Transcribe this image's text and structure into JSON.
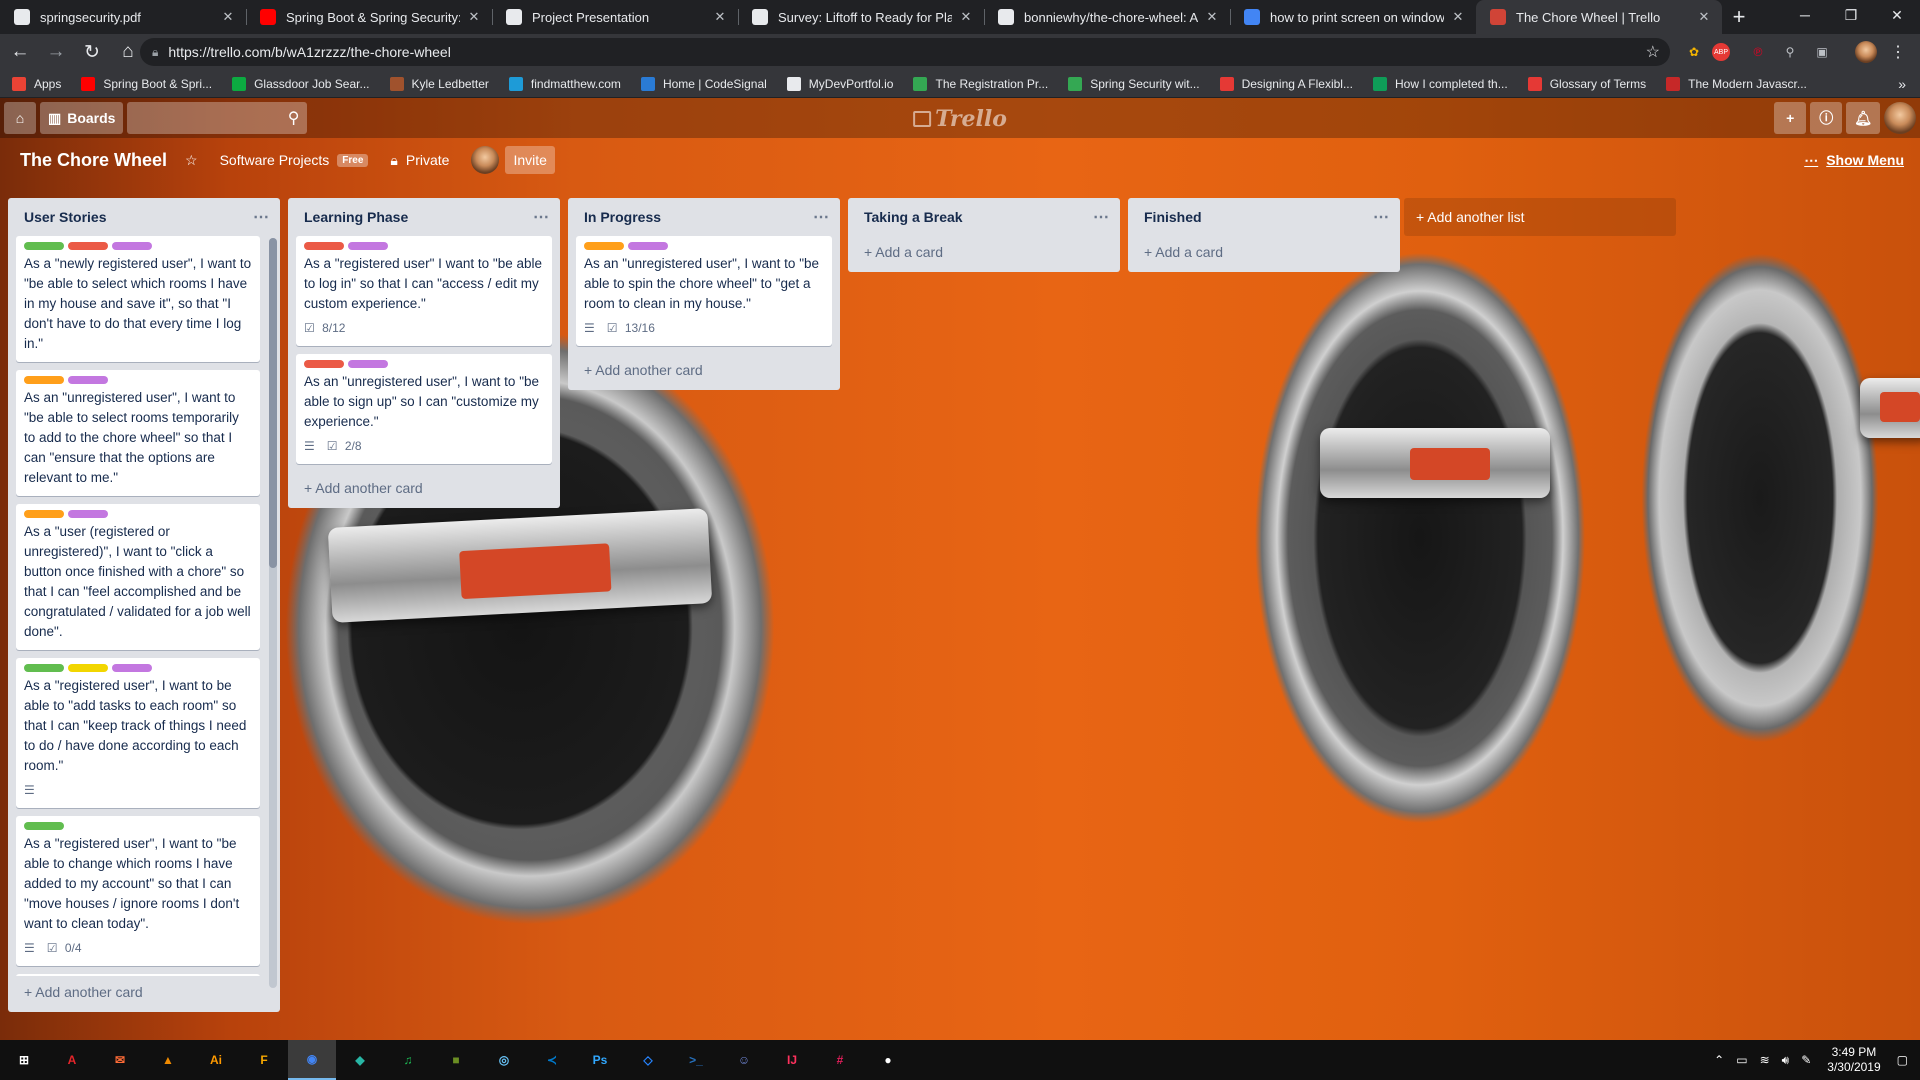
{
  "browser": {
    "tabs": [
      {
        "title": "springsecurity.pdf",
        "icon": "document-icon",
        "color": "#e8eaed"
      },
      {
        "title": "Spring Boot & Spring Security: D",
        "icon": "youtube-icon",
        "color": "#ff0000"
      },
      {
        "title": "Project Presentation",
        "icon": "presentation-icon",
        "color": "#e8eaed"
      },
      {
        "title": "Survey: Liftoff to Ready for Placem",
        "icon": "survey-icon",
        "color": "#e8eaed"
      },
      {
        "title": "bonniewhy/the-chore-wheel: A h",
        "icon": "github-icon",
        "color": "#e8eaed"
      },
      {
        "title": "how to print screen on windows",
        "icon": "google-icon",
        "color": "#4285f4"
      },
      {
        "title": "The Chore Wheel | Trello",
        "icon": "trello-icon",
        "color": "#d04437",
        "active": true
      }
    ],
    "url": "https://trello.com/b/wA1zrzzz/the-chore-wheel",
    "bookmarks": [
      {
        "label": "Apps",
        "color": "#ea4335"
      },
      {
        "label": "Spring Boot & Spri...",
        "color": "#ff0000"
      },
      {
        "label": "Glassdoor Job Sear...",
        "color": "#0caa41"
      },
      {
        "label": "Kyle Ledbetter",
        "color": "#a0522d"
      },
      {
        "label": "findmatthew.com",
        "color": "#1e9bd7"
      },
      {
        "label": "Home | CodeSignal",
        "color": "#2a7bd5"
      },
      {
        "label": "MyDevPortfol.io",
        "color": "#e8eaed"
      },
      {
        "label": "The Registration Pr...",
        "color": "#34a853"
      },
      {
        "label": "Spring Security wit...",
        "color": "#34a853"
      },
      {
        "label": "Designing A Flexibl...",
        "color": "#e53935"
      },
      {
        "label": "How I completed th...",
        "color": "#0f9d58"
      },
      {
        "label": "Glossary of Terms",
        "color": "#e53935"
      },
      {
        "label": "The Modern Javascr...",
        "color": "#c62828"
      }
    ]
  },
  "trello": {
    "boards_label": "Boards",
    "logo": "Trello",
    "board_title": "The Chore Wheel",
    "team": "Software Projects",
    "team_badge": "Free",
    "visibility": "Private",
    "invite": "Invite",
    "show_menu": "Show Menu",
    "add_list": "+ Add another list",
    "lists": [
      {
        "title": "User Stories",
        "add": "+ Add another card",
        "cards": [
          {
            "labels": [
              "#61bd4f",
              "#eb5a46",
              "#c377e0"
            ],
            "text": "As a \"newly registered user\", I want to \"be able to select which rooms I have in my house and save it\", so that \"I don't have to do that every time I log in.\""
          },
          {
            "labels": [
              "#ff9f1a",
              "#c377e0"
            ],
            "text": "As an \"unregistered user\", I want to \"be able to select rooms temporarily to add to the chore wheel\" so that I can \"ensure that the options are relevant to me.\""
          },
          {
            "labels": [
              "#ff9f1a",
              "#c377e0"
            ],
            "text": "As a \"user (registered or unregistered)\", I want to \"click a button once finished with a chore\" so that I can \"feel accomplished and be congratulated / validated for a job well done\"."
          },
          {
            "labels": [
              "#61bd4f",
              "#f2d600",
              "#c377e0"
            ],
            "text": "As a \"registered user\", I want to be able to \"add tasks to each room\" so that I can \"keep track of things I need to do / have done according to each room.\"",
            "desc": true
          },
          {
            "labels": [
              "#61bd4f"
            ],
            "text": "As a \"registered user\", I want to \"be able to change which rooms I have added to my account\" so that I can \"move houses / ignore rooms I don't want to clean today\".",
            "desc": true,
            "check": "0/4"
          },
          {
            "labels": [
              "#eb5a46",
              "#00c2e0"
            ],
            "text": ""
          }
        ]
      },
      {
        "title": "Learning Phase",
        "add": "+ Add another card",
        "cards": [
          {
            "labels": [
              "#eb5a46",
              "#c377e0"
            ],
            "text": "As a \"registered user\" I want to \"be able to log in\" so that I can \"access / edit my custom experience.\"",
            "check": "8/12"
          },
          {
            "labels": [
              "#eb5a46",
              "#c377e0"
            ],
            "text": "As an \"unregistered user\", I want to \"be able to sign up\" so I can \"customize my experience.\"",
            "desc": true,
            "check": "2/8"
          }
        ]
      },
      {
        "title": "In Progress",
        "add": "+ Add another card",
        "cards": [
          {
            "labels": [
              "#ff9f1a",
              "#c377e0"
            ],
            "text": "As an \"unregistered user\", I want to \"be able to spin the chore wheel\" to \"get a room to clean in my house.\"",
            "desc": true,
            "check": "13/16"
          }
        ]
      },
      {
        "title": "Taking a Break",
        "add": "+ Add a card",
        "cards": []
      },
      {
        "title": "Finished",
        "add": "+ Add a card",
        "cards": []
      }
    ]
  },
  "taskbar": {
    "apps": [
      {
        "name": "start-icon",
        "glyph": "⊞",
        "color": "#ffffff"
      },
      {
        "name": "acrobat-icon",
        "glyph": "A",
        "color": "#e5252a"
      },
      {
        "name": "postman-icon",
        "glyph": "✉",
        "color": "#ff6c37"
      },
      {
        "name": "vlc-icon",
        "glyph": "▲",
        "color": "#f08a00"
      },
      {
        "name": "illustrator-icon",
        "glyph": "Ai",
        "color": "#ff9a00"
      },
      {
        "name": "filezilla-icon",
        "glyph": "F",
        "color": "#f6a800"
      },
      {
        "name": "chrome-icon",
        "glyph": "◉",
        "color": "#4285f4"
      },
      {
        "name": "gitkraken-icon",
        "glyph": "◆",
        "color": "#28b6a5"
      },
      {
        "name": "spotify-icon",
        "glyph": "♫",
        "color": "#1db954"
      },
      {
        "name": "minecraft-icon",
        "glyph": "■",
        "color": "#6b8e23"
      },
      {
        "name": "steam-icon",
        "glyph": "◎",
        "color": "#66c0f4"
      },
      {
        "name": "vscode-icon",
        "glyph": "≺",
        "color": "#007acc"
      },
      {
        "name": "photoshop-icon",
        "glyph": "Ps",
        "color": "#31a8ff"
      },
      {
        "name": "sourcetree-icon",
        "glyph": "◇",
        "color": "#2684ff"
      },
      {
        "name": "powershell-icon",
        "glyph": ">_",
        "color": "#2671be"
      },
      {
        "name": "discord-icon",
        "glyph": "☺",
        "color": "#7289da"
      },
      {
        "name": "intellij-icon",
        "glyph": "IJ",
        "color": "#fe315d"
      },
      {
        "name": "slack-icon",
        "glyph": "#",
        "color": "#e01e5a"
      },
      {
        "name": "github-desktop-icon",
        "glyph": "●",
        "color": "#ffffff"
      }
    ],
    "time": "3:49 PM",
    "date": "3/30/2019"
  }
}
